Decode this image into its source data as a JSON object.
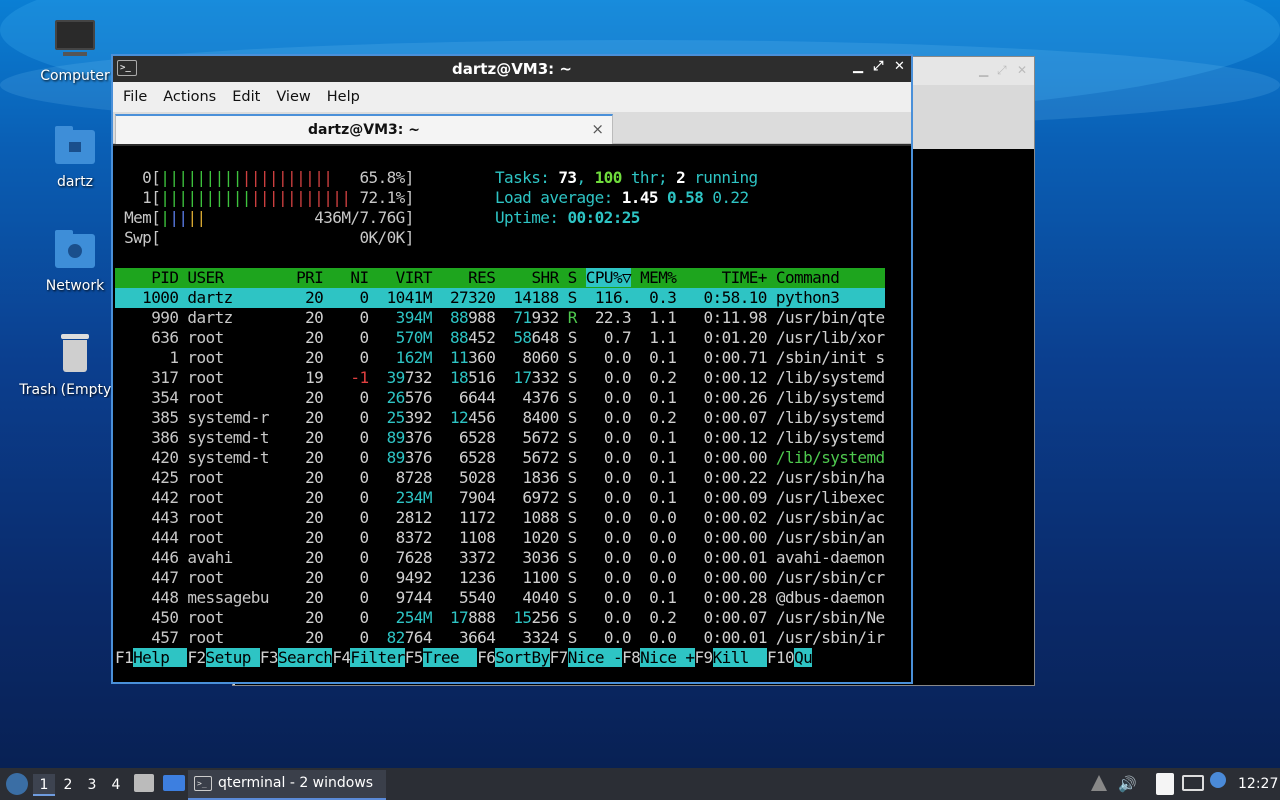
{
  "desktop": {
    "icons": [
      {
        "label": "Computer"
      },
      {
        "label": "dartz"
      },
      {
        "label": "Network"
      },
      {
        "label": "Trash (Empty)"
      }
    ]
  },
  "window": {
    "title": "dartz@VM3: ~",
    "menu": [
      "File",
      "Actions",
      "Edit",
      "View",
      "Help"
    ],
    "tab_label": "dartz@VM3: ~",
    "tab_close": "×"
  },
  "htop": {
    "cpu0_label": "0[",
    "cpu0_pct": "65.8%]",
    "cpu1_label": "1[",
    "cpu1_pct": "72.1%]",
    "mem_label": "Mem[",
    "mem_value": "436M/7.76G]",
    "swp_label": "Swp[",
    "swp_value": "0K/0K]",
    "tasks_label": "Tasks: ",
    "tasks_count": "73",
    "thr_count": "100",
    "thr_label": " thr; ",
    "running_count": "2",
    "running_label": " running",
    "load_label": "Load average: ",
    "load_1": "1.45",
    "load_5": "0.58",
    "load_15": "0.22",
    "uptime_label": "Uptime: ",
    "uptime_value": "00:02:25",
    "columns": [
      "PID",
      "USER",
      "PRI",
      "NI",
      "VIRT",
      "RES",
      "SHR",
      "S",
      "CPU%▽",
      "MEM%",
      "TIME+",
      "Command"
    ],
    "rows": [
      [
        "1000",
        "dartz",
        "20",
        "0",
        "1041M",
        "27320",
        "14188",
        "S",
        "116.",
        "0.3",
        "0:58.10",
        "python3"
      ],
      [
        "990",
        "dartz",
        "20",
        "0",
        "394M",
        "88988",
        "71932",
        "R",
        "22.3",
        "1.1",
        "0:11.98",
        "/usr/bin/qte"
      ],
      [
        "636",
        "root",
        "20",
        "0",
        "570M",
        "88452",
        "58648",
        "S",
        "0.7",
        "1.1",
        "0:01.20",
        "/usr/lib/xor"
      ],
      [
        "1",
        "root",
        "20",
        "0",
        "162M",
        "11360",
        "8060",
        "S",
        "0.0",
        "0.1",
        "0:00.71",
        "/sbin/init s"
      ],
      [
        "317",
        "root",
        "19",
        "-1",
        "39732",
        "18516",
        "17332",
        "S",
        "0.0",
        "0.2",
        "0:00.12",
        "/lib/systemd"
      ],
      [
        "354",
        "root",
        "20",
        "0",
        "26576",
        "6644",
        "4376",
        "S",
        "0.0",
        "0.1",
        "0:00.26",
        "/lib/systemd"
      ],
      [
        "385",
        "systemd-r",
        "20",
        "0",
        "25392",
        "12456",
        "8400",
        "S",
        "0.0",
        "0.2",
        "0:00.07",
        "/lib/systemd"
      ],
      [
        "386",
        "systemd-t",
        "20",
        "0",
        "89376",
        "6528",
        "5672",
        "S",
        "0.0",
        "0.1",
        "0:00.12",
        "/lib/systemd"
      ],
      [
        "420",
        "systemd-t",
        "20",
        "0",
        "89376",
        "6528",
        "5672",
        "S",
        "0.0",
        "0.1",
        "0:00.00",
        "/lib/systemd"
      ],
      [
        "425",
        "root",
        "20",
        "0",
        "8728",
        "5028",
        "1836",
        "S",
        "0.0",
        "0.1",
        "0:00.22",
        "/usr/sbin/ha"
      ],
      [
        "442",
        "root",
        "20",
        "0",
        "234M",
        "7904",
        "6972",
        "S",
        "0.0",
        "0.1",
        "0:00.09",
        "/usr/libexec"
      ],
      [
        "443",
        "root",
        "20",
        "0",
        "2812",
        "1172",
        "1088",
        "S",
        "0.0",
        "0.0",
        "0:00.02",
        "/usr/sbin/ac"
      ],
      [
        "444",
        "root",
        "20",
        "0",
        "8372",
        "1108",
        "1020",
        "S",
        "0.0",
        "0.0",
        "0:00.00",
        "/usr/sbin/an"
      ],
      [
        "446",
        "avahi",
        "20",
        "0",
        "7628",
        "3372",
        "3036",
        "S",
        "0.0",
        "0.0",
        "0:00.01",
        "avahi-daemon"
      ],
      [
        "447",
        "root",
        "20",
        "0",
        "9492",
        "1236",
        "1100",
        "S",
        "0.0",
        "0.0",
        "0:00.00",
        "/usr/sbin/cr"
      ],
      [
        "448",
        "messagebu",
        "20",
        "0",
        "9744",
        "5540",
        "4040",
        "S",
        "0.0",
        "0.1",
        "0:00.28",
        "@dbus-daemon"
      ],
      [
        "450",
        "root",
        "20",
        "0",
        "254M",
        "17888",
        "15256",
        "S",
        "0.0",
        "0.2",
        "0:00.07",
        "/usr/sbin/Ne"
      ],
      [
        "457",
        "root",
        "20",
        "0",
        "82764",
        "3664",
        "3324",
        "S",
        "0.0",
        "0.0",
        "0:00.01",
        "/usr/sbin/ir"
      ]
    ],
    "fkeys": [
      {
        "key": "F1",
        "label": "Help  "
      },
      {
        "key": "F2",
        "label": "Setup "
      },
      {
        "key": "F3",
        "label": "Search"
      },
      {
        "key": "F4",
        "label": "Filter"
      },
      {
        "key": "F5",
        "label": "Tree  "
      },
      {
        "key": "F6",
        "label": "SortBy"
      },
      {
        "key": "F7",
        "label": "Nice -"
      },
      {
        "key": "F8",
        "label": "Nice +"
      },
      {
        "key": "F9",
        "label": "Kill  "
      },
      {
        "key": "F10",
        "label": "Qu"
      }
    ]
  },
  "taskbar": {
    "workspaces": [
      "1",
      "2",
      "3",
      "4"
    ],
    "task_label": "qterminal - 2 windows",
    "clock": "12:27",
    "icons": [
      "start-menu-icon",
      "file-manager-icon",
      "show-desktop-icon",
      "terminal-icon",
      "notification-up-icon",
      "volume-icon",
      "clipboard-icon",
      "network-icon",
      "updates-icon"
    ]
  },
  "colors": {
    "accent": "#4a90d9",
    "htop_header": "#1ea51e",
    "htop_select": "#2ec4c4",
    "cyan": "#2ec4c4",
    "green": "#4ec94e",
    "red": "#e04040"
  }
}
